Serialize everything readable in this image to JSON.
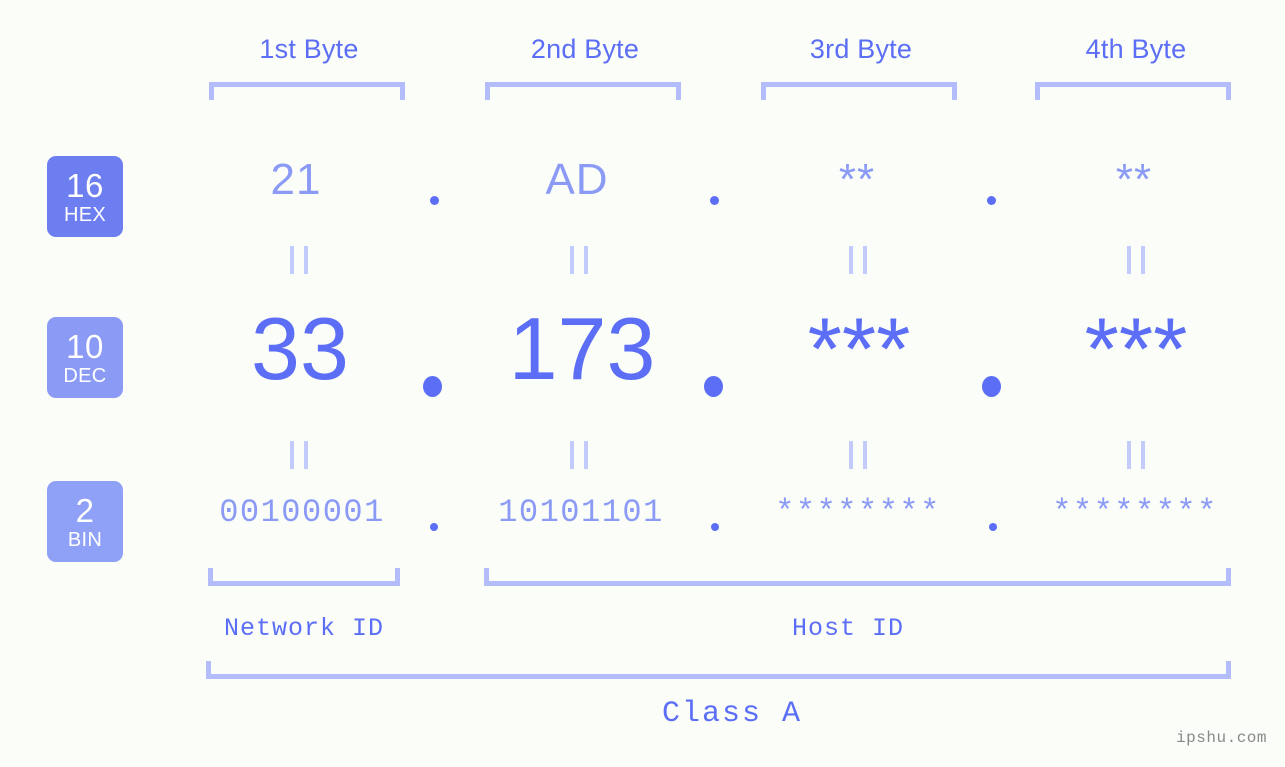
{
  "headers": [
    {
      "label": "1st Byte"
    },
    {
      "label": "2nd Byte"
    },
    {
      "label": "3rd Byte"
    },
    {
      "label": "4th Byte"
    }
  ],
  "rows": {
    "hex": {
      "badge_num": "16",
      "badge_name": "HEX",
      "values": [
        "21",
        "AD",
        "**",
        "**"
      ],
      "separator": "."
    },
    "dec": {
      "badge_num": "10",
      "badge_name": "DEC",
      "values": [
        "33",
        "173",
        "***",
        "***"
      ],
      "separator": "."
    },
    "bin": {
      "badge_num": "2",
      "badge_name": "BIN",
      "values": [
        "00100001",
        "10101101",
        "********",
        "********"
      ],
      "separator": "."
    }
  },
  "equals_symbol": "=",
  "sections": {
    "network_id": "Network ID",
    "host_id": "Host ID",
    "class": "Class A"
  },
  "watermark": "ipshu.com",
  "colors": {
    "background": "#fbfdf8",
    "accent_strong": "#5b6ef5",
    "accent_mid": "#8b9bf5",
    "accent_light": "#b3bdfb",
    "badge_hex": "#6c7ef0",
    "badge_dec": "#8b9bf5",
    "badge_bin": "#8fa1f7",
    "watermark": "#8a8a8a"
  }
}
